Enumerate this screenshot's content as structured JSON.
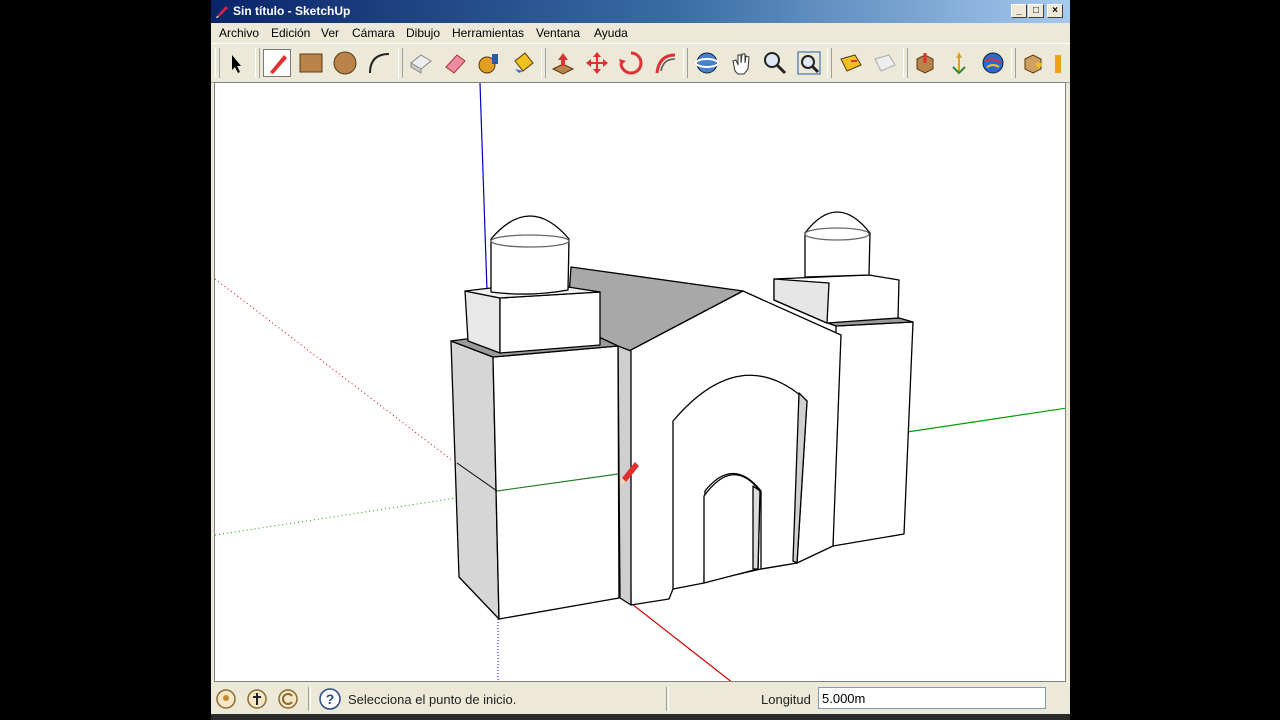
{
  "window": {
    "title": "Sin título - SketchUp",
    "minimize": "_",
    "maximize": "□",
    "close": "×"
  },
  "menu": [
    "Archivo",
    "Edición",
    "Ver",
    "Cámara",
    "Dibujo",
    "Herramientas",
    "Ventana",
    "Ayuda"
  ],
  "toolbar": {
    "tools": [
      "select-tool",
      "pencil-line-tool",
      "rectangle-tool",
      "circle-tool",
      "arc-tool",
      "make-component-tool",
      "eraser-tool",
      "tape-measure-tool",
      "paint-bucket-tool",
      "push-pull-tool",
      "move-tool",
      "rotate-tool",
      "follow-me-tool",
      "orbit-tool",
      "pan-tool",
      "zoom-tool",
      "zoom-extents-tool",
      "section-plane-tool",
      "hide-tool",
      "get-models-tool",
      "walk-tool",
      "google-earth-tool",
      "components-tool",
      "position-camera-tool"
    ],
    "active_tool": "pencil-line-tool"
  },
  "status": {
    "hint": "Selecciona el punto de inicio.",
    "vcb_label": "Longitud",
    "vcb_value": "5.000m"
  },
  "colors": {
    "axis_red": "#d00000",
    "axis_green": "#00a000",
    "axis_blue": "#0000c0",
    "face_light": "#ffffff",
    "face_shade": "#cfcfcf",
    "face_roof": "#a8a8a8"
  }
}
